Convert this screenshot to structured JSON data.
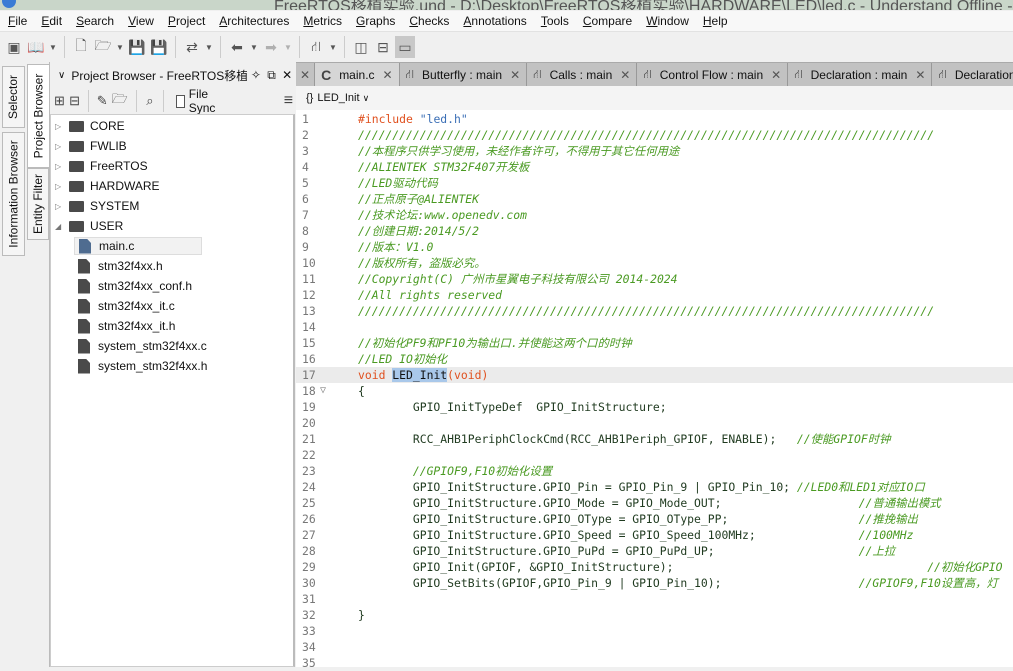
{
  "window": {
    "title": "FreeRTOS移植实验.und - D:\\Desktop\\FreeRTOS移植实验\\HARDWARE\\LED\\led.c - Understand Offline - (r"
  },
  "menu": [
    {
      "key": "F",
      "rest": "ile"
    },
    {
      "key": "E",
      "rest": "dit"
    },
    {
      "key": "S",
      "rest": "earch"
    },
    {
      "key": "V",
      "rest": "iew"
    },
    {
      "key": "P",
      "rest": "roject"
    },
    {
      "key": "A",
      "rest": "rchitectures"
    },
    {
      "key": "M",
      "rest": "etrics"
    },
    {
      "key": "G",
      "rest": "raphs"
    },
    {
      "key": "C",
      "rest": "hecks"
    },
    {
      "key": "A",
      "rest": "nnotations"
    },
    {
      "key": "T",
      "rest": "ools"
    },
    {
      "key": "C",
      "rest": "ompare"
    },
    {
      "key": "W",
      "rest": "indow"
    },
    {
      "key": "H",
      "rest": "elp"
    }
  ],
  "side_tabs": {
    "selector": "Selector",
    "info": "Information Browser",
    "project": "Project Browser",
    "entity": "Entity Filter"
  },
  "panel": {
    "title": "Project Browser - FreeRTOS移植实验",
    "file_sync": "File Sync",
    "file_sync_checked": false
  },
  "tree": [
    {
      "label": "CORE",
      "type": "folder",
      "expanded": false
    },
    {
      "label": "FWLIB",
      "type": "folder",
      "expanded": false
    },
    {
      "label": "FreeRTOS",
      "type": "folder",
      "expanded": false
    },
    {
      "label": "HARDWARE",
      "type": "folder",
      "expanded": false
    },
    {
      "label": "SYSTEM",
      "type": "folder",
      "expanded": false
    },
    {
      "label": "USER",
      "type": "folder",
      "expanded": true
    },
    {
      "label": "main.c",
      "type": "file",
      "selected": true
    },
    {
      "label": "stm32f4xx.h",
      "type": "file"
    },
    {
      "label": "stm32f4xx_conf.h",
      "type": "file"
    },
    {
      "label": "stm32f4xx_it.c",
      "type": "file"
    },
    {
      "label": "stm32f4xx_it.h",
      "type": "file"
    },
    {
      "label": "system_stm32f4xx.c",
      "type": "file"
    },
    {
      "label": "system_stm32f4xx.h",
      "type": "file"
    }
  ],
  "tabs": [
    {
      "label": "main.c",
      "icon": "c-file-icon",
      "active": true
    },
    {
      "label": "Butterfly : main",
      "icon": "graph-icon"
    },
    {
      "label": "Calls : main",
      "icon": "graph-icon"
    },
    {
      "label": "Control Flow : main",
      "icon": "graph-icon"
    },
    {
      "label": "Declaration : main",
      "icon": "graph-icon"
    },
    {
      "label": "Declaration File : main",
      "icon": "graph-icon"
    }
  ],
  "breadcrumb": {
    "function": "LED_Init"
  },
  "code": [
    [
      [
        "kw",
        "#include "
      ],
      [
        "str",
        "\"led.h\""
      ]
    ],
    [
      [
        "cm",
        "////////////////////////////////////////////////////////////////////////////////////"
      ]
    ],
    [
      [
        "cm",
        "//本程序只供学习使用，未经作者许可，不得用于其它任何用途"
      ]
    ],
    [
      [
        "cm",
        "//ALIENTEK STM32F407开发板"
      ]
    ],
    [
      [
        "cm",
        "//LED驱动代码"
      ]
    ],
    [
      [
        "cm",
        "//正点原子@ALIENTEK"
      ]
    ],
    [
      [
        "cm",
        "//技术论坛:www.openedv.com"
      ]
    ],
    [
      [
        "cm",
        "//创建日期:2014/5/2"
      ]
    ],
    [
      [
        "cm",
        "//版本：V1.0"
      ]
    ],
    [
      [
        "cm",
        "//版权所有，盗版必究。"
      ]
    ],
    [
      [
        "cm",
        "//Copyright(C) 广州市星翼电子科技有限公司 2014-2024"
      ]
    ],
    [
      [
        "cm",
        "//All rights reserved"
      ]
    ],
    [
      [
        "cm",
        "////////////////////////////////////////////////////////////////////////////////////"
      ]
    ],
    [],
    [
      [
        "cm",
        "//初始化PF9和PF10为输出口.并使能这两个口的时钟"
      ]
    ],
    [
      [
        "cm",
        "//LED IO初始化"
      ]
    ],
    [
      [
        "kw",
        "void "
      ],
      [
        "hl",
        "LED_Init"
      ],
      [
        "kw",
        "(void)"
      ]
    ],
    [
      [
        "id",
        "{"
      ]
    ],
    [
      [
        "id",
        "        GPIO_InitTypeDef  GPIO_InitStructure;"
      ]
    ],
    [],
    [
      [
        "id",
        "        RCC_AHB1PeriphClockCmd(RCC_AHB1Periph_GPIOF, ENABLE);   "
      ],
      [
        "cm",
        "//使能GPIOF时钟"
      ]
    ],
    [],
    [
      [
        "cm",
        "        //GPIOF9,F10初始化设置"
      ]
    ],
    [
      [
        "id",
        "        GPIO_InitStructure.GPIO_Pin = GPIO_Pin_9 | GPIO_Pin_10; "
      ],
      [
        "cm",
        "//LED0和LED1对应IO口"
      ]
    ],
    [
      [
        "id",
        "        GPIO_InitStructure.GPIO_Mode = GPIO_Mode_OUT;                    "
      ],
      [
        "cm",
        "//普通输出模式"
      ]
    ],
    [
      [
        "id",
        "        GPIO_InitStructure.GPIO_OType = GPIO_OType_PP;                   "
      ],
      [
        "cm",
        "//推挽输出"
      ]
    ],
    [
      [
        "id",
        "        GPIO_InitStructure.GPIO_Speed = GPIO_Speed_100MHz;               "
      ],
      [
        "cm",
        "//100MHz"
      ]
    ],
    [
      [
        "id",
        "        GPIO_InitStructure.GPIO_PuPd = GPIO_PuPd_UP;                     "
      ],
      [
        "cm",
        "//上拉"
      ]
    ],
    [
      [
        "id",
        "        GPIO_Init(GPIOF, &GPIO_InitStructure);                                     "
      ],
      [
        "cm",
        "//初始化GPIO"
      ]
    ],
    [
      [
        "id",
        "        GPIO_SetBits(GPIOF,GPIO_Pin_9 | GPIO_Pin_10);                    "
      ],
      [
        "cm",
        "//GPIOF9,F10设置高，灯"
      ]
    ],
    [],
    [
      [
        "id",
        "}"
      ]
    ],
    [],
    [],
    []
  ],
  "current_line": 17,
  "fold_line": 18,
  "colors": {
    "keyword": "#e0501e",
    "string": "#3b6fb6",
    "comment": "#4a9a22",
    "selection": "#a9c8ea"
  }
}
